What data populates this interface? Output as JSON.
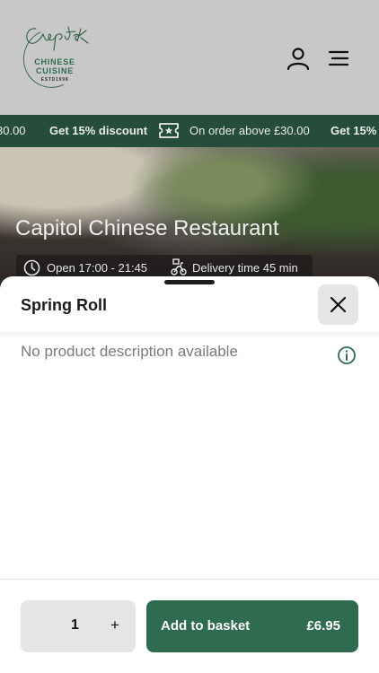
{
  "header": {
    "logo": {
      "script": "Capitol",
      "line1": "CHINESE",
      "line2": "CUISINE",
      "line3": "ESTD1998"
    },
    "user_icon": "user-icon",
    "menu_icon": "hamburger-menu-icon"
  },
  "promo": {
    "items": [
      "30.00",
      "Get 15% discount",
      "On order above £30.00",
      "Get 15%"
    ],
    "icon": "ticket-star-icon",
    "color": "#264d3a"
  },
  "hero": {
    "title": "Capitol Chinese Restaurant",
    "open_hours": "Open 17:00 - 21:45",
    "delivery": "Delivery time 45 min"
  },
  "sheet": {
    "title": "Spring Roll",
    "description": "No product description available",
    "close_icon": "close-icon",
    "info_icon": "info-icon"
  },
  "footer": {
    "quantity": "1",
    "plus": "+",
    "add_label": "Add to basket",
    "price": "£6.95",
    "accent": "#2e6b4f"
  }
}
